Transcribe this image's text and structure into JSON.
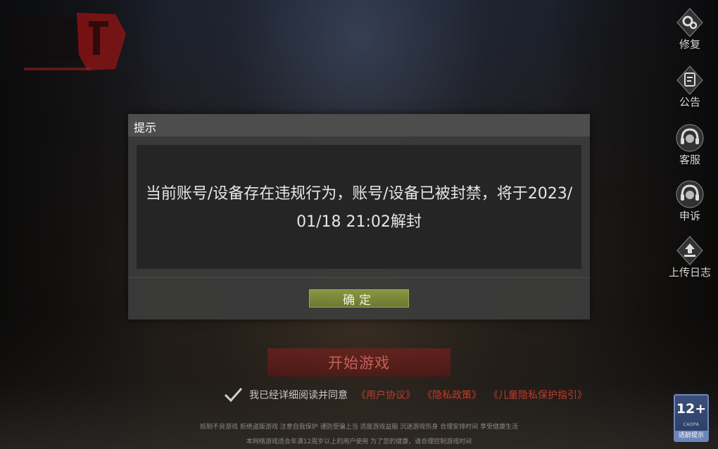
{
  "side_menu": [
    {
      "label": "修复",
      "icon": "gear-repair-icon"
    },
    {
      "label": "公告",
      "icon": "notice-icon"
    },
    {
      "label": "客服",
      "icon": "headset-icon"
    },
    {
      "label": "申诉",
      "icon": "headset-appeal-icon"
    },
    {
      "label": "上传日志",
      "icon": "upload-icon"
    }
  ],
  "start_button": {
    "label": "开始游戏"
  },
  "agreement": {
    "checked": true,
    "text": "我已经详细阅读并同意",
    "links": [
      "《用户协议》",
      "《隐私政策》",
      "《儿童隐私保护指引》"
    ]
  },
  "health_notice": {
    "line1": "抵制不良游戏 拒绝盗版游戏 注意自我保护 谨防受骗上当 适度游戏益脑 沉迷游戏伤身 合理安排时间 享受健康生活",
    "line2": "本网络游戏适合年满12周岁以上的用户使用    为了您的健康，请合理控制游戏时间"
  },
  "age_badge": {
    "rating": "12+",
    "org": "CADPA",
    "tip": "适龄提示"
  },
  "dialog": {
    "title": "提示",
    "message": "当前账号/设备存在违规行为，账号/设备已被封禁，将于2023/01/18 21:02解封",
    "confirm_label": "确定"
  },
  "colors": {
    "dialog_bg": "#3c3c3c",
    "confirm_button": "#7a8638",
    "link": "#c0392b",
    "start_button": "#8c1e1e"
  }
}
